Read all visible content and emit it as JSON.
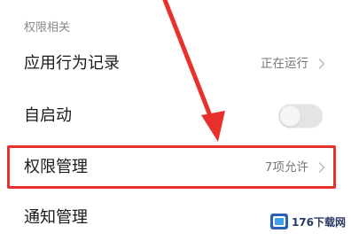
{
  "section": {
    "header": "权限相关"
  },
  "rows": [
    {
      "label": "应用行为记录",
      "value": "正在运行"
    },
    {
      "label": "自启动",
      "toggle_on": false
    },
    {
      "label": "权限管理",
      "value": "7项允许",
      "highlighted": true
    },
    {
      "label": "通知管理"
    }
  ],
  "annotation": {
    "color": "#e8312d"
  },
  "watermark": {
    "text": "176下载网",
    "logo_icon": "176-logo-icon"
  }
}
